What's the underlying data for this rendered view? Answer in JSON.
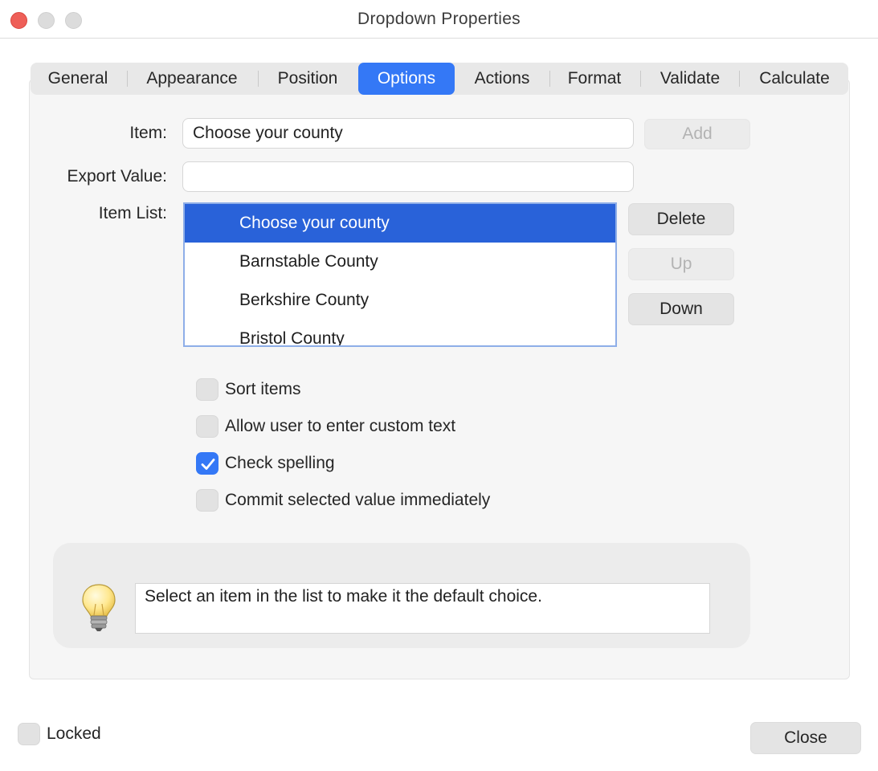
{
  "window": {
    "title": "Dropdown Properties"
  },
  "tabs": [
    {
      "label": "General"
    },
    {
      "label": "Appearance"
    },
    {
      "label": "Position"
    },
    {
      "label": "Options"
    },
    {
      "label": "Actions"
    },
    {
      "label": "Format"
    },
    {
      "label": "Validate"
    },
    {
      "label": "Calculate"
    }
  ],
  "active_tab": "Options",
  "item": {
    "label": "Item:",
    "value": "Choose your county"
  },
  "export_value": {
    "label": "Export Value:",
    "value": ""
  },
  "item_list": {
    "label": "Item List:",
    "items": [
      "Choose your county",
      "Barnstable County",
      "Berkshire County",
      "Bristol County"
    ],
    "selected": "Choose your county"
  },
  "buttons": {
    "add": "Add",
    "delete": "Delete",
    "up": "Up",
    "down": "Down",
    "close": "Close"
  },
  "options": [
    {
      "label": "Sort items",
      "checked": false
    },
    {
      "label": "Allow user to enter custom text",
      "checked": false
    },
    {
      "label": "Check spelling",
      "checked": true
    },
    {
      "label": "Commit selected value immediately",
      "checked": false
    }
  ],
  "hint": {
    "text": "Select an item in the list to make it the default choice.",
    "icon": "lightbulb-icon"
  },
  "locked": {
    "label": "Locked",
    "checked": false
  },
  "colors": {
    "accent": "#3478f6",
    "selection": "#2962d9"
  }
}
